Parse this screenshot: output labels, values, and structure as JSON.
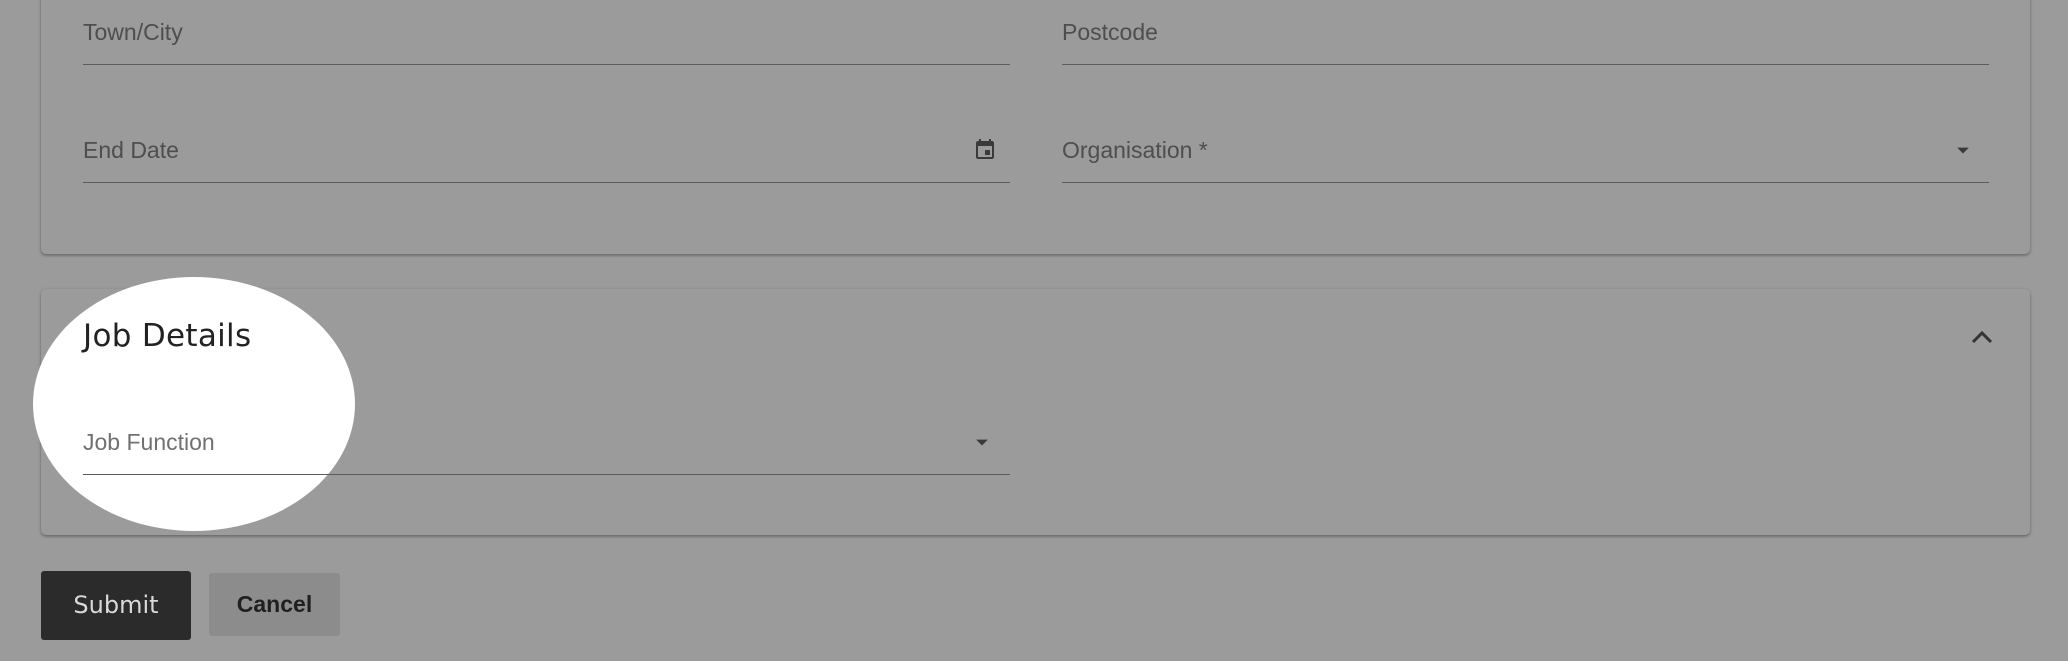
{
  "address": {
    "town_label": "Town/City",
    "postcode_label": "Postcode",
    "end_date_label": "End Date",
    "organisation_label": "Organisation *"
  },
  "job_details": {
    "title": "Job Details",
    "job_function_label": "Job Function"
  },
  "actions": {
    "submit_label": "Submit",
    "cancel_label": "Cancel"
  },
  "icons": {
    "calendar": "calendar-icon",
    "dropdown": "arrow-drop-down-icon",
    "collapse": "chevron-up-icon"
  },
  "colors": {
    "background": "#9b9b9b",
    "spotlight": "#ffffff",
    "submit_bg": "#2b2b2b",
    "cancel_bg": "#8c8c8c"
  }
}
